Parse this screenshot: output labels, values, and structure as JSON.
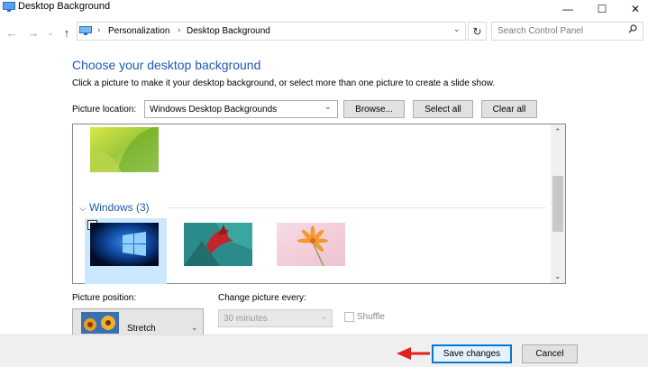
{
  "window": {
    "title": "Desktop Background",
    "minimize_glyph": "—",
    "maximize_glyph": "☐",
    "close_glyph": "✕"
  },
  "address_bar": {
    "breadcrumbs": [
      "Personalization",
      "Desktop Background"
    ],
    "separator": "›",
    "search_placeholder": "Search Control Panel"
  },
  "main": {
    "heading": "Choose your desktop background",
    "instruction": "Click a picture to make it your desktop background, or select more than one picture to create a slide show.",
    "picture_location_label": "Picture location:",
    "picture_location_value": "Windows Desktop Backgrounds",
    "browse_label": "Browse...",
    "select_all_label": "Select all",
    "clear_all_label": "Clear all"
  },
  "picture_list": {
    "group_label": "Windows (3)",
    "pictures": [
      {
        "name": "windows-logo",
        "selected": true
      },
      {
        "name": "tropical-plant",
        "selected": false
      },
      {
        "name": "pink-flower",
        "selected": false
      }
    ]
  },
  "options": {
    "picture_position_label": "Picture position:",
    "picture_position_value": "Stretch",
    "change_picture_label": "Change picture every:",
    "change_picture_value": "30 minutes",
    "shuffle_label": "Shuffle"
  },
  "footer": {
    "save_label": "Save changes",
    "cancel_label": "Cancel"
  },
  "colors": {
    "accent": "#1e5ab0",
    "selection": "#cce8ff",
    "focus_border": "#0078d7",
    "annotation_arrow": "#e01f1f"
  }
}
